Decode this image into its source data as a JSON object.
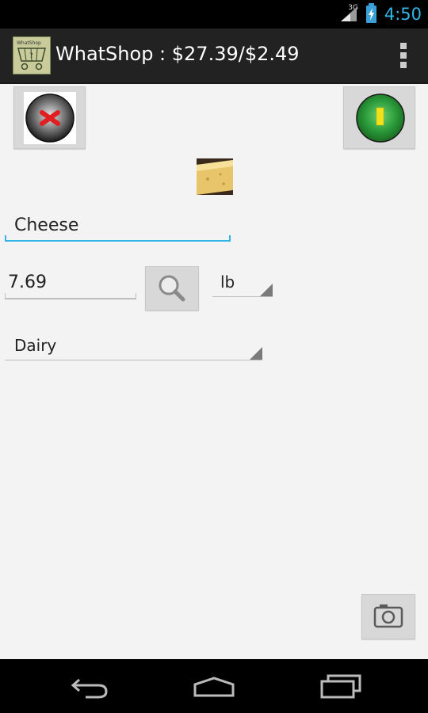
{
  "status_bar": {
    "network_label": "3G",
    "time": "4:50"
  },
  "action_bar": {
    "app_icon_label": "WhatShop",
    "title": "WhatShop : $27.39/$2.49"
  },
  "form": {
    "name_value": "Cheese",
    "price_value": "7.69",
    "unit_selected": "lb",
    "category_selected": "Dairy"
  },
  "colors": {
    "accent": "#33b5e5",
    "cancel_red": "#e02020",
    "ok_green": "#2a9a3a",
    "ok_yellow": "#f2e11a"
  }
}
